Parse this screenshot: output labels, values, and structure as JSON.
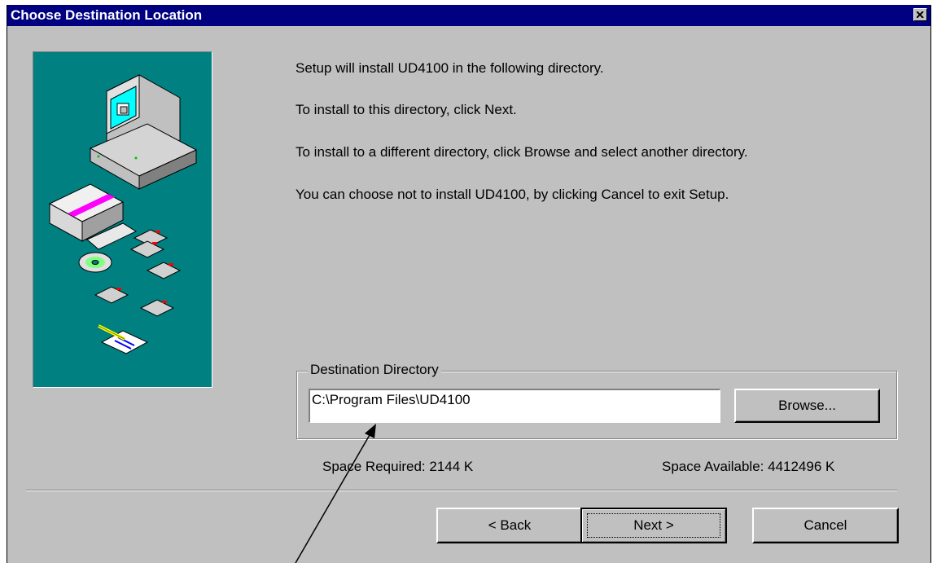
{
  "window": {
    "title": "Choose Destination Location",
    "close_icon": "close-x-icon"
  },
  "messages": [
    "Setup will install UD4100 in the following directory.",
    "To install to this directory, click Next.",
    "To install to a different directory, click Browse and select another directory.",
    "You can choose not to install UD4100, by clicking Cancel to exit Setup."
  ],
  "destination": {
    "group_label": "Destination Directory",
    "path": "C:\\Program Files\\UD4100",
    "browse_label": "Browse..."
  },
  "space": {
    "required": "Space Required:  2144 K",
    "available": "Space Available:  4412496 K"
  },
  "buttons": {
    "back_label": "< Back",
    "next_label": "Next >",
    "cancel_label": "Cancel"
  },
  "colors": {
    "titlebar": "#000080",
    "dialog_bg": "#c0c0c0",
    "art_bg": "#008080"
  }
}
